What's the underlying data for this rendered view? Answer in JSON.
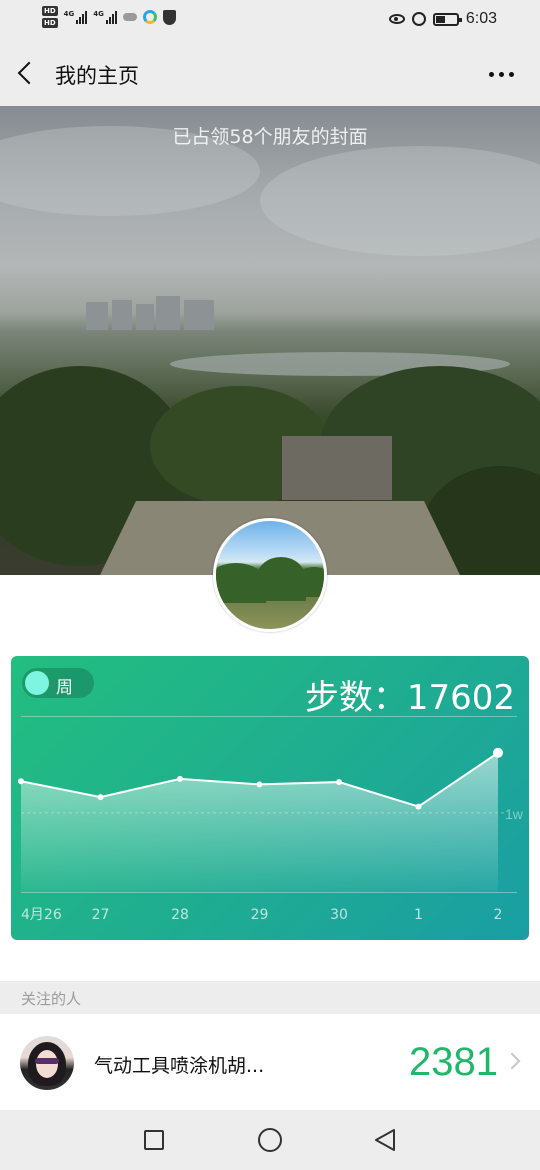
{
  "status_bar": {
    "left_icons": [
      "hd-icon",
      "signal-4g-icon",
      "signal-4g-icon",
      "cloud-icon",
      "app-icon",
      "shield-icon"
    ],
    "network_label_1": "HD",
    "network_label_2": "HD",
    "sig_tag_1": "4G",
    "sig_tag_2": "4G",
    "right_icons": [
      "eye-icon",
      "alarm-icon",
      "battery-icon"
    ],
    "time": "6:03"
  },
  "nav": {
    "title": "我的主页",
    "back_icon": "back-icon",
    "more_icon": "more-icon"
  },
  "cover": {
    "caption": "已占领58个朋友的封面"
  },
  "step_card": {
    "toggle_label": "周",
    "steps_text": "步数：17602"
  },
  "chart_data": {
    "type": "area",
    "categories": [
      "4月26",
      "27",
      "28",
      "29",
      "30",
      "1",
      "2"
    ],
    "values": [
      14000,
      12000,
      14300,
      13600,
      13900,
      10800,
      17602
    ],
    "reference_label": "1w",
    "reference_value": 10000,
    "ylim": [
      0,
      22000
    ],
    "grid": false,
    "colors": {
      "line": "#ffffff",
      "fill_top": "rgba(255,255,255,0.55)",
      "fill_bottom": "rgba(255,255,255,0.05)"
    }
  },
  "follow": {
    "header": "关注的人",
    "items": [
      {
        "name": "气动工具喷涂机胡...",
        "steps": "2381"
      }
    ]
  },
  "system_nav": {
    "buttons": [
      "square-icon",
      "home-icon",
      "back-icon"
    ]
  },
  "colors": {
    "accent_green": "#1fb86a",
    "card_start": "#23be80",
    "card_end": "#1a9ea3"
  }
}
